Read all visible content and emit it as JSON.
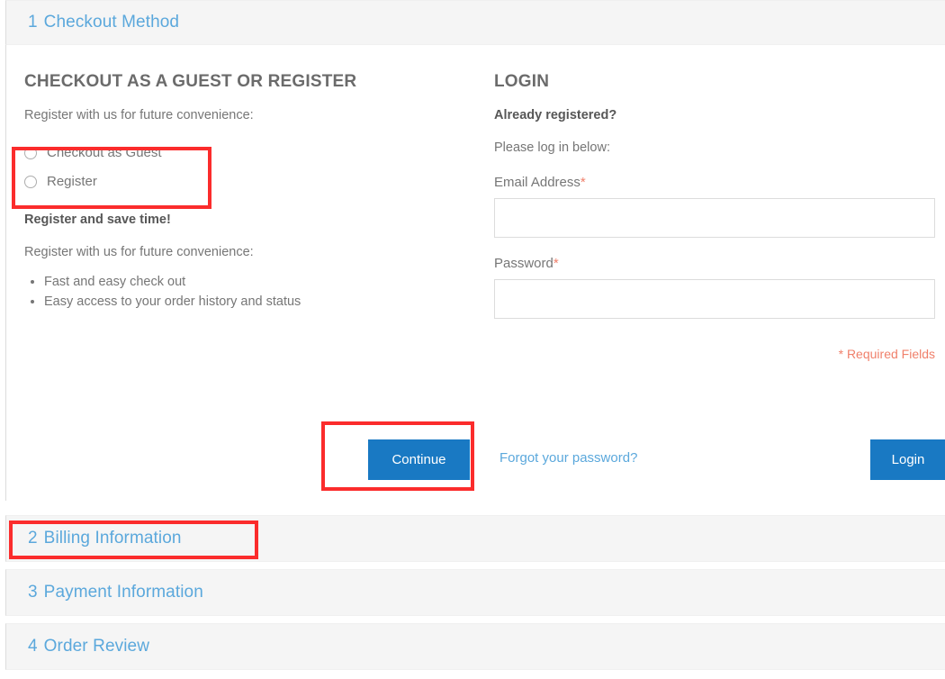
{
  "steps": [
    {
      "number": "1",
      "title": "Checkout Method",
      "state": "expanded"
    },
    {
      "number": "2",
      "title": "Billing Information",
      "state": "collapsed"
    },
    {
      "number": "3",
      "title": "Payment Information",
      "state": "collapsed"
    },
    {
      "number": "4",
      "title": "Order Review",
      "state": "collapsed"
    }
  ],
  "guest": {
    "heading": "CHECKOUT AS A GUEST OR REGISTER",
    "intro": "Register with us for future convenience:",
    "options": [
      {
        "label": "Checkout as Guest",
        "selected": false
      },
      {
        "label": "Register",
        "selected": false
      }
    ],
    "save_time_heading": "Register and save time!",
    "save_time_intro": "Register with us for future convenience:",
    "benefits": [
      "Fast and easy check out",
      "Easy access to your order history and status"
    ],
    "continue_label": "Continue"
  },
  "login": {
    "heading": "LOGIN",
    "already_registered": "Already registered?",
    "please_log_in": "Please log in below:",
    "email_label": "Email Address",
    "email_value": "",
    "email_placeholder": "",
    "password_label": "Password",
    "password_value": "",
    "password_placeholder": "",
    "required_marker": "*",
    "required_fields_note": "* Required Fields",
    "forgot_password_label": "Forgot your password?",
    "login_label": "Login"
  },
  "colors": {
    "accent_blue": "#1979c3",
    "link_blue": "#5BA8DC",
    "required_red": "#f0806b",
    "annotation_red": "#fb2c2c",
    "panel_gray": "#f5f5f5",
    "text_gray": "#767676"
  }
}
